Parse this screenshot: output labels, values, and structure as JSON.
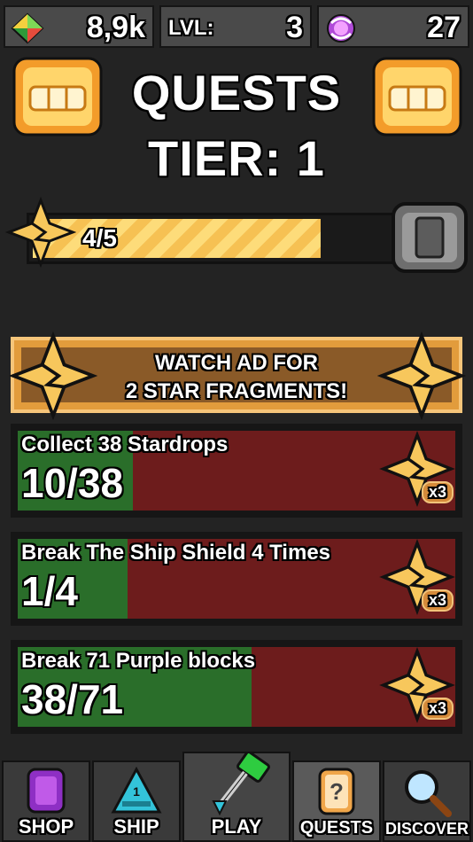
{
  "stats": {
    "gems": "8,9k",
    "level_label": "LVL:",
    "level": "3",
    "currency": "27"
  },
  "header": {
    "title": "QUESTS",
    "tier": "TIER: 1"
  },
  "tier_progress": {
    "text": "4/5",
    "fraction": 0.8
  },
  "ad": {
    "line1": "WATCH AD FOR",
    "line2": "2 STAR FRAGMENTS!"
  },
  "quests": [
    {
      "name": "Collect 38 Stardrops",
      "progress": "10/38",
      "current": 10,
      "total": 38,
      "reward": "x3"
    },
    {
      "name": "Break The Ship Shield 4 Times",
      "progress": "1/4",
      "current": 1,
      "total": 4,
      "reward": "x3"
    },
    {
      "name": "Break 71 Purple blocks",
      "progress": "38/71",
      "current": 38,
      "total": 71,
      "reward": "x3"
    }
  ],
  "nav": {
    "shop": "SHOP",
    "ship": "SHIP",
    "ship_badge": "1",
    "play": "PLAY",
    "quests": "QUESTS",
    "quests_icon": "?",
    "discover": "DISCOVER"
  },
  "icons": {
    "gem": "gem-icon",
    "currency": "swirl-coin-icon",
    "chest": "chest-icon",
    "star_fragment": "star-fragment-icon",
    "tier_chest": "locked-chest-icon"
  },
  "colors": {
    "quest_done": "#2a6e2a",
    "quest_remaining": "#6d1c1c",
    "accent": "#f6c153"
  }
}
